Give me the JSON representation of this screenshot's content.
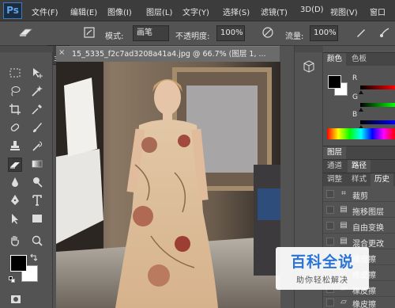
{
  "app": {
    "logo": "Ps"
  },
  "menu": [
    "文件(F)",
    "编辑(E)",
    "图像(I)",
    "图层(L)",
    "文字(Y)",
    "选择(S)",
    "滤镜(T)",
    "3D(D)",
    "视图(V)",
    "窗口"
  ],
  "options": {
    "brush_size": "34",
    "mode_label": "模式:",
    "mode_value": "画笔",
    "opacity_label": "不透明度:",
    "opacity_value": "100%",
    "flow_label": "流量:",
    "flow_value": "100%"
  },
  "document": {
    "tab_title": "15_5335_f2c7ad3208a41a4.jpg @ 66.7% (图层 1, ...",
    "close_glyph": "×"
  },
  "panels": {
    "color_tab": "颜色",
    "swatches_tab": "色板",
    "slider_r": "R",
    "slider_g": "G",
    "slider_b": "B",
    "layers_tab": "图层",
    "channels_tab": "通道",
    "paths_tab": "路径",
    "adjust_tab": "调整",
    "styles_tab": "样式",
    "history_tab": "历史"
  },
  "history": [
    "裁剪",
    "拖移图层",
    "自由变换",
    "混合更改",
    "橡皮擦",
    "橡皮擦",
    "橡皮擦",
    "橡皮擦"
  ],
  "watermark": {
    "title": "百科全说",
    "subtitle": "助你轻松解决"
  },
  "colors": {
    "foreground": "#000000",
    "background": "#ffffff",
    "accent": "#2a74d8"
  }
}
